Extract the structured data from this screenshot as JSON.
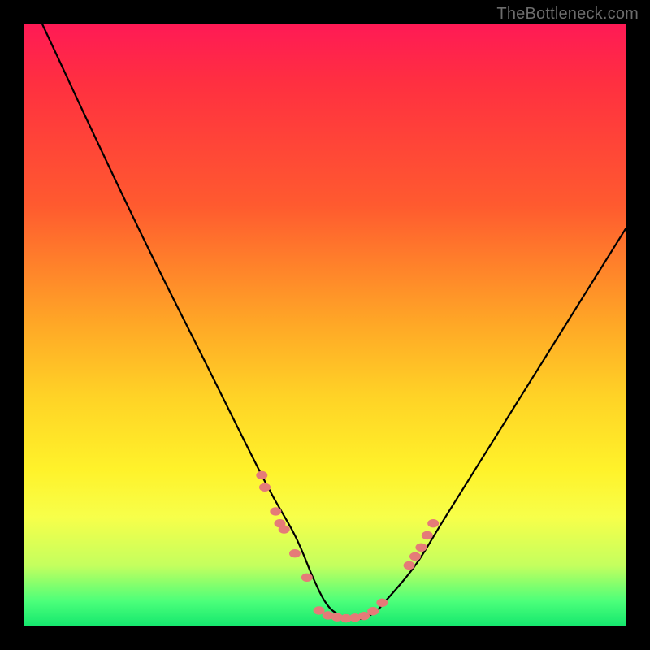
{
  "watermark": "TheBottleneck.com",
  "colors": {
    "curve": "#000000",
    "marker": "#e57b78",
    "gradient_top": "#ff1a55",
    "gradient_bottom": "#16e86e",
    "frame": "#000000"
  },
  "chart_data": {
    "type": "line",
    "title": "",
    "xlabel": "",
    "ylabel": "",
    "xlim": [
      0,
      100
    ],
    "ylim": [
      0,
      100
    ],
    "axes_visible": false,
    "grid": false,
    "series": [
      {
        "name": "bottleneck-curve",
        "x": [
          3,
          10,
          20,
          30,
          40,
          45,
          48,
          50,
          52,
          55,
          58,
          60,
          65,
          70,
          80,
          90,
          100
        ],
        "y": [
          100,
          85,
          64,
          44,
          24,
          15,
          8,
          4,
          2,
          1,
          2,
          4,
          10,
          18,
          34,
          50,
          66
        ]
      }
    ],
    "markers": [
      {
        "x": 39.5,
        "y": 25
      },
      {
        "x": 40.0,
        "y": 23
      },
      {
        "x": 41.8,
        "y": 19
      },
      {
        "x": 42.5,
        "y": 17
      },
      {
        "x": 43.2,
        "y": 16
      },
      {
        "x": 45.0,
        "y": 12
      },
      {
        "x": 47.0,
        "y": 8
      },
      {
        "x": 49.0,
        "y": 2.5
      },
      {
        "x": 50.5,
        "y": 1.7
      },
      {
        "x": 52.0,
        "y": 1.4
      },
      {
        "x": 53.5,
        "y": 1.2
      },
      {
        "x": 55.0,
        "y": 1.3
      },
      {
        "x": 56.5,
        "y": 1.6
      },
      {
        "x": 58.0,
        "y": 2.4
      },
      {
        "x": 59.5,
        "y": 3.8
      },
      {
        "x": 64.0,
        "y": 10
      },
      {
        "x": 65.0,
        "y": 11.5
      },
      {
        "x": 66.0,
        "y": 13
      },
      {
        "x": 67.0,
        "y": 15
      },
      {
        "x": 68.0,
        "y": 17
      }
    ]
  }
}
